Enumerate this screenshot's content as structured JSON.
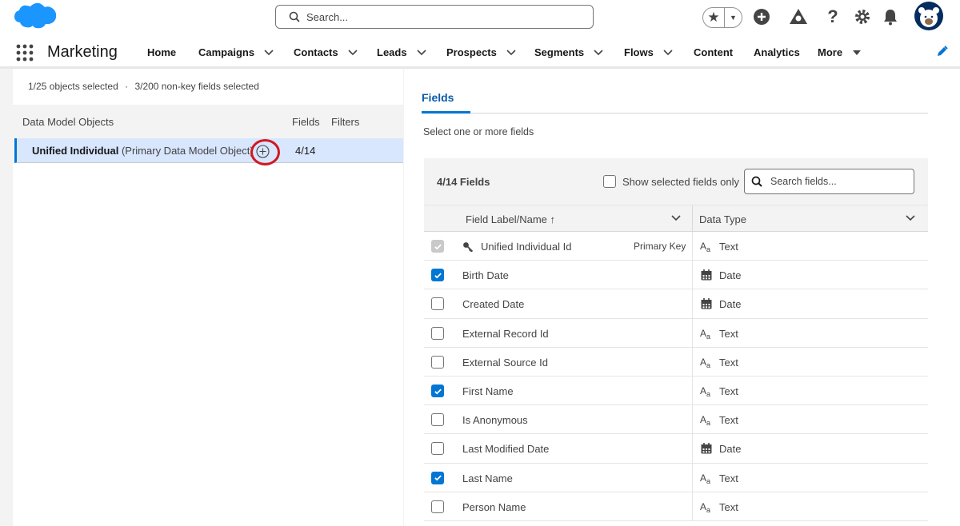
{
  "header": {
    "search_placeholder": "Search...",
    "colors": {
      "brand": "#1b96ff",
      "accent": "#0176d3",
      "highlight": "#d0191f"
    }
  },
  "app": {
    "name": "Marketing",
    "nav": [
      {
        "label": "Home",
        "dropdown": false
      },
      {
        "label": "Campaigns",
        "dropdown": true
      },
      {
        "label": "Contacts",
        "dropdown": true
      },
      {
        "label": "Leads",
        "dropdown": true
      },
      {
        "label": "Prospects",
        "dropdown": true
      },
      {
        "label": "Segments",
        "dropdown": true
      },
      {
        "label": "Flows",
        "dropdown": true
      },
      {
        "label": "Content",
        "dropdown": false
      },
      {
        "label": "Analytics",
        "dropdown": false
      },
      {
        "label": "More",
        "dropdown": true
      }
    ]
  },
  "left": {
    "summary_objects": "1/25 objects selected",
    "summary_sep": "·",
    "summary_fields": "3/200 non-key fields selected",
    "columns": {
      "objects": "Data Model Objects",
      "fields": "Fields",
      "filters": "Filters"
    },
    "object": {
      "name": "Unified Individual",
      "qualifier": "(Primary Data Model Object)",
      "count": "4/14"
    }
  },
  "right": {
    "tab": "Fields",
    "instructions": "Select one or more fields",
    "count": "4/14 Fields",
    "show_selected_label": "Show selected fields only",
    "search_placeholder": "Search fields...",
    "col_label": "Field Label/Name",
    "col_sort": "↑",
    "col_type": "Data Type",
    "rows": [
      {
        "label": "Unified Individual Id",
        "checked": true,
        "disabled": true,
        "key": "Primary Key",
        "type": "Text",
        "type_icon": "text-type-icon"
      },
      {
        "label": "Birth Date",
        "checked": true,
        "disabled": false,
        "key": "",
        "type": "Date",
        "type_icon": "calendar-icon"
      },
      {
        "label": "Created Date",
        "checked": false,
        "disabled": false,
        "key": "",
        "type": "Date",
        "type_icon": "calendar-icon"
      },
      {
        "label": "External Record Id",
        "checked": false,
        "disabled": false,
        "key": "",
        "type": "Text",
        "type_icon": "text-type-icon"
      },
      {
        "label": "External Source Id",
        "checked": false,
        "disabled": false,
        "key": "",
        "type": "Text",
        "type_icon": "text-type-icon"
      },
      {
        "label": "First Name",
        "checked": true,
        "disabled": false,
        "key": "",
        "type": "Text",
        "type_icon": "text-type-icon"
      },
      {
        "label": "Is Anonymous",
        "checked": false,
        "disabled": false,
        "key": "",
        "type": "Text",
        "type_icon": "text-type-icon"
      },
      {
        "label": "Last Modified Date",
        "checked": false,
        "disabled": false,
        "key": "",
        "type": "Date",
        "type_icon": "calendar-icon"
      },
      {
        "label": "Last Name",
        "checked": true,
        "disabled": false,
        "key": "",
        "type": "Text",
        "type_icon": "text-type-icon"
      },
      {
        "label": "Person Name",
        "checked": false,
        "disabled": false,
        "key": "",
        "type": "Text",
        "type_icon": "text-type-icon"
      }
    ]
  }
}
